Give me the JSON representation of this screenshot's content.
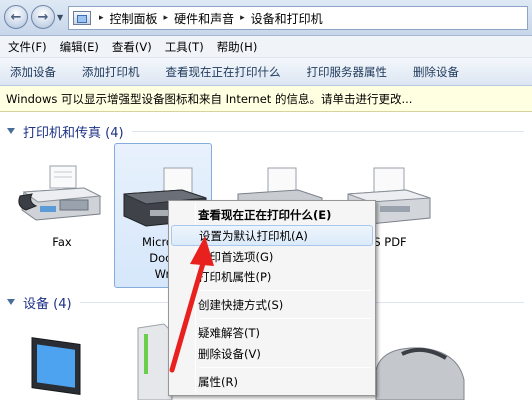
{
  "address_bar": {
    "breadcrumbs": [
      "控制面板",
      "硬件和声音",
      "设备和打印机"
    ],
    "separator": "▸"
  },
  "menu": [
    "文件(F)",
    "编辑(E)",
    "查看(V)",
    "工具(T)",
    "帮助(H)"
  ],
  "commands": [
    "添加设备",
    "添加打印机",
    "查看现在正在打印什么",
    "打印服务器属性",
    "删除设备"
  ],
  "info_bar": "Windows 可以显示增强型设备图标和来自 Internet 的信息。请单击进行更改...",
  "groups": {
    "printers": "打印机和传真 (4)",
    "devices": "设备 (4)"
  },
  "printers": [
    {
      "label": "Fax"
    },
    {
      "label_lines": [
        "Microso",
        "Docu",
        "Wri"
      ]
    },
    {
      "label": ""
    },
    {
      "label": "S PDF"
    }
  ],
  "context_menu": [
    {
      "label": "查看现在正在打印什么(E)",
      "bold": true,
      "highlighted": false
    },
    {
      "label": "设置为默认打印机(A)",
      "bold": false,
      "highlighted": true
    },
    {
      "label": "打印首选项(G)",
      "bold": false,
      "highlighted": false
    },
    {
      "label": "打印机属性(P)",
      "bold": false,
      "highlighted": false
    },
    {
      "label": "创建快捷方式(S)",
      "bold": false,
      "highlighted": false
    },
    {
      "label": "疑难解答(T)",
      "bold": false,
      "highlighted": false
    },
    {
      "label": "删除设备(V)",
      "bold": false,
      "highlighted": false
    },
    {
      "label": "属性(R)",
      "bold": false,
      "highlighted": false
    }
  ],
  "colors": {
    "group_title": "#1e3287",
    "command_text": "#1e395b",
    "info_bar_bg": "#ffffe1",
    "annotation": "#e8201e"
  }
}
